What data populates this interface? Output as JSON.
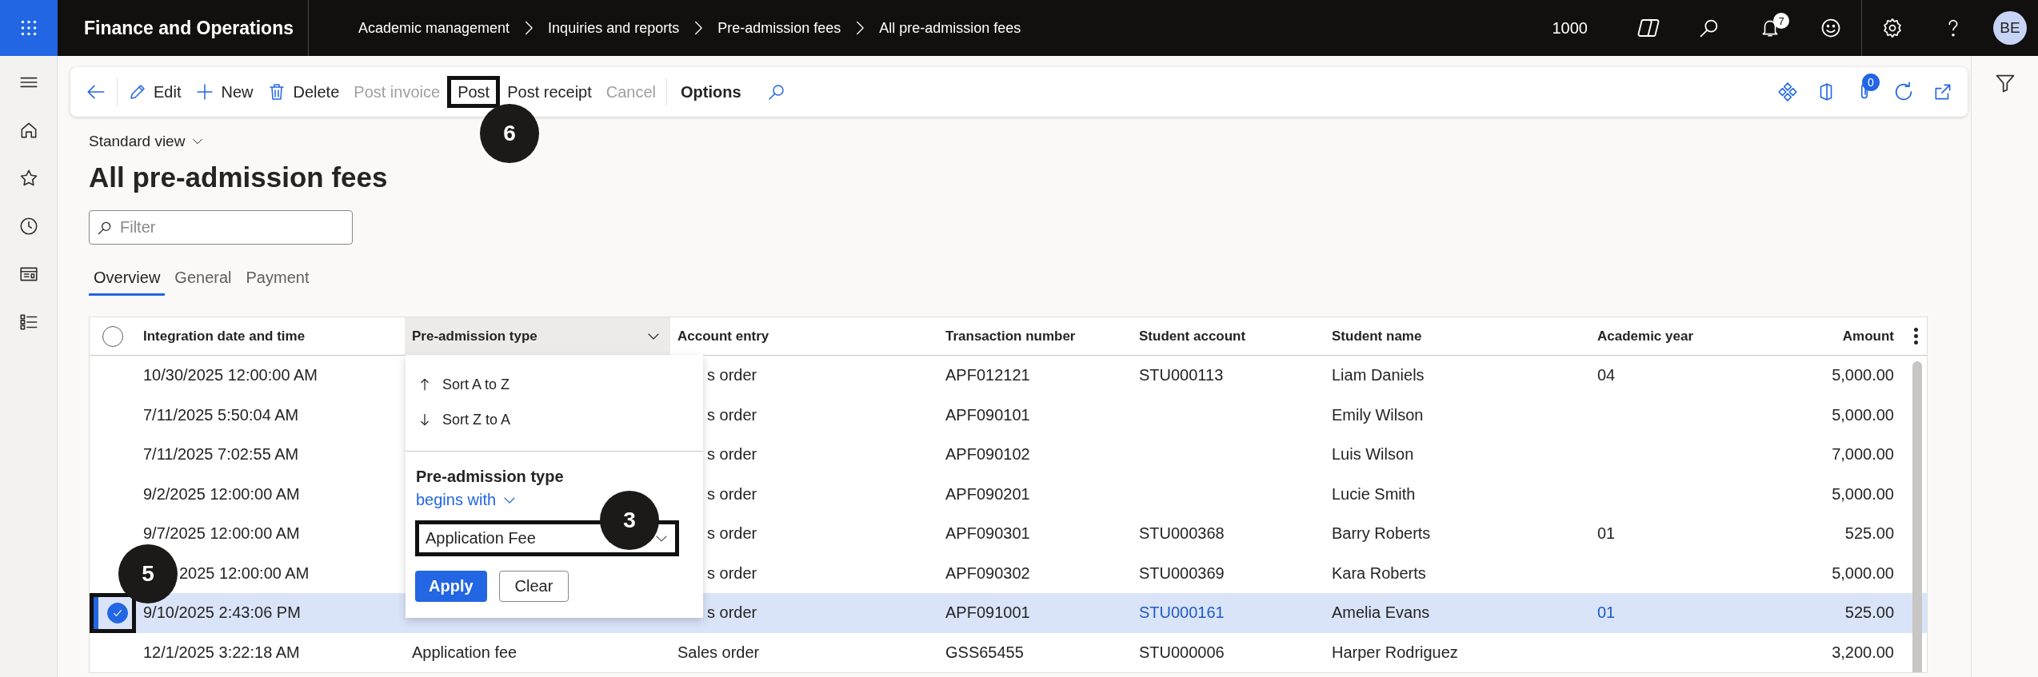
{
  "app_bar": {
    "title": "Finance and Operations",
    "breadcrumb": [
      "Academic management",
      "Inquiries and reports",
      "Pre-admission fees",
      "All pre-admission fees"
    ],
    "company": "1000",
    "notification_count": "7",
    "avatar_initials": "BE"
  },
  "action_pane": {
    "buttons": [
      {
        "kind": "back"
      },
      {
        "kind": "edit",
        "label": "Edit",
        "disabled": false
      },
      {
        "kind": "new",
        "label": "New",
        "disabled": false
      },
      {
        "kind": "delete",
        "label": "Delete",
        "disabled": false
      },
      {
        "kind": "plain",
        "label": "Post invoice",
        "disabled": true
      },
      {
        "kind": "plain",
        "label": "Post",
        "disabled": false,
        "callout": "6"
      },
      {
        "kind": "plain",
        "label": "Post receipt",
        "disabled": false
      },
      {
        "kind": "plain",
        "label": "Cancel",
        "disabled": true
      },
      {
        "kind": "options",
        "label": "Options",
        "disabled": false
      },
      {
        "kind": "search"
      }
    ],
    "attachment_count": "0"
  },
  "page": {
    "view": "Standard view",
    "title": "All pre-admission fees",
    "filter": {
      "placeholder": "Filter"
    },
    "tabs": [
      {
        "label": "Overview",
        "selected": true
      },
      {
        "label": "General",
        "selected": false
      },
      {
        "label": "Payment",
        "selected": false
      }
    ]
  },
  "grid": {
    "all_selected": false,
    "columns": [
      {
        "label": "Integration date and time",
        "kind": "text",
        "filtered": false
      },
      {
        "label": "Pre-admission type",
        "kind": "text",
        "filtered": true
      },
      {
        "label": "Account entry",
        "kind": "text",
        "filtered": false
      },
      {
        "label": "Transaction number",
        "kind": "text",
        "filtered": false
      },
      {
        "label": "Student account",
        "kind": "text",
        "filtered": false
      },
      {
        "label": "Student name",
        "kind": "text",
        "filtered": false
      },
      {
        "label": "Academic year",
        "kind": "text",
        "filtered": false
      },
      {
        "label": "Amount",
        "kind": "number",
        "filtered": false
      }
    ],
    "rows": [
      {
        "integration_date": "10/30/2025 12:00:00 AM",
        "account_entry": "s order",
        "transaction_number": "APF012121",
        "student_account": "STU000113",
        "student_name": "Liam Daniels",
        "academic_year": "04",
        "amount": "5,000.00",
        "selected": false
      },
      {
        "integration_date": "7/11/2025 5:50:04 AM",
        "account_entry": "s order",
        "transaction_number": "APF090101",
        "student_name": "Emily Wilson",
        "amount": "5,000.00",
        "selected": false
      },
      {
        "integration_date": "7/11/2025 7:02:55 AM",
        "account_entry": "s order",
        "transaction_number": "APF090102",
        "student_name": "Luis Wilson",
        "amount": "7,000.00",
        "selected": false
      },
      {
        "integration_date": "9/2/2025 12:00:00 AM",
        "account_entry": "s order",
        "transaction_number": "APF090201",
        "student_name": "Lucie Smith",
        "amount": "5,000.00",
        "selected": false
      },
      {
        "integration_date": "9/7/2025 12:00:00 AM",
        "account_entry": "s order",
        "transaction_number": "APF090301",
        "student_account": "STU000368",
        "student_name": "Barry Roberts",
        "academic_year": "01",
        "amount": "525.00",
        "selected": false
      },
      {
        "integration_date": "2025 12:00:00 AM",
        "behind_callout": true,
        "account_entry": "s order",
        "transaction_number": "APF090302",
        "student_account": "STU000369",
        "student_name": "Kara Roberts",
        "amount": "5,000.00",
        "selected": false
      },
      {
        "integration_date": "9/10/2025 2:43:06 PM",
        "account_entry": "s order",
        "transaction_number": "APF091001",
        "student_account": "STU000161",
        "student_name": "Amelia Evans",
        "academic_year": "01",
        "amount": "525.00",
        "selected": true,
        "callout": "5"
      },
      {
        "integration_date": "12/1/2025 3:22:18 AM",
        "pre_admission_type": "Application fee",
        "account_entry": "Sales order",
        "transaction_number": "GSS65455",
        "student_account": "STU000006",
        "student_name": "Harper Rodriguez",
        "amount": "3,200.00",
        "selected": false
      }
    ]
  },
  "column_menu": {
    "sort_items": [
      {
        "kind": "ascending",
        "label": "Sort A to Z"
      },
      {
        "kind": "descending",
        "label": "Sort Z to A"
      }
    ],
    "field_label": "Pre-admission type",
    "operator": "begins with",
    "value": "Application Fee",
    "value_callout": "3",
    "apply": "Apply",
    "clear": "Clear"
  }
}
